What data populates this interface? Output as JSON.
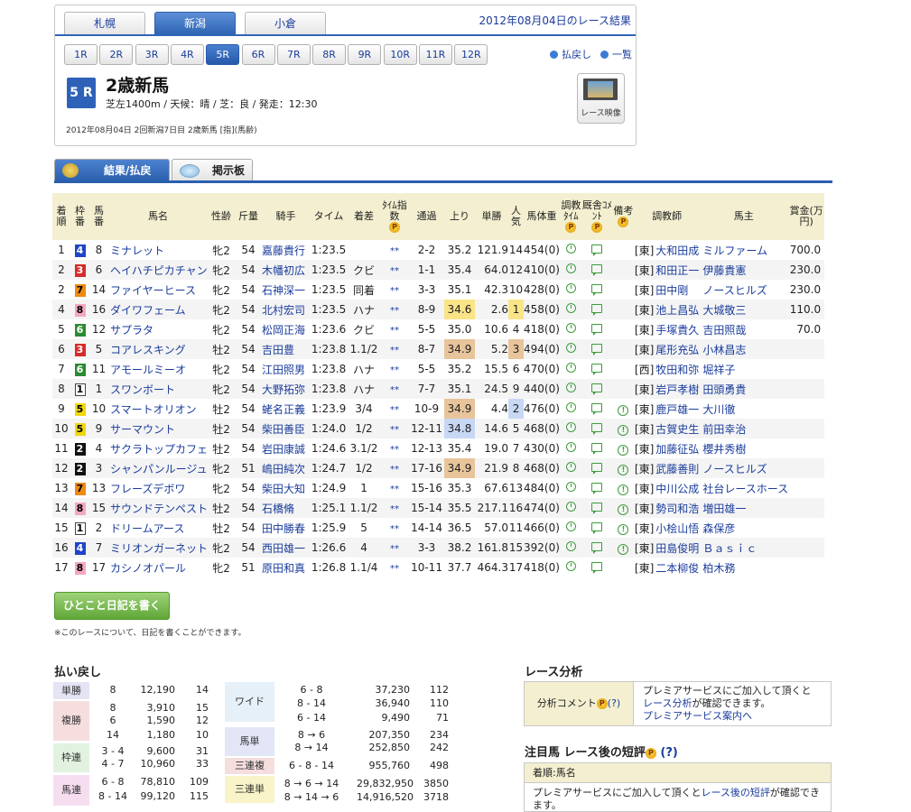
{
  "venues": [
    "札幌",
    "新潟",
    "小倉"
  ],
  "active_venue": 1,
  "date_title": "2012年08月04日のレース結果",
  "race_buttons": [
    "1R",
    "2R",
    "3R",
    "4R",
    "5R",
    "6R",
    "7R",
    "8R",
    "9R",
    "10R",
    "11R",
    "12R"
  ],
  "active_race": 4,
  "links": {
    "payout": "払戻し",
    "list": "一覧"
  },
  "race": {
    "badge": "5 R",
    "name": "2歳新馬",
    "conditions": "芝左1400m /  天候：晴 /  芝：良  /  発走：12:30",
    "info": "2012年08月04日 2回新潟7日目 2歳新馬  [指](馬齢)"
  },
  "video_label": "レース映像",
  "result_tabs": [
    "結果/払戻",
    "掲示板"
  ],
  "headers": {
    "rank": "着順",
    "waku": "枠番",
    "num": "馬番",
    "name": "馬名",
    "sexage": "性齢",
    "weight": "斤量",
    "jockey": "騎手",
    "time": "タイム",
    "margin": "着差",
    "index": "ﾀｲﾑ指数",
    "pass": "通過",
    "last": "上り",
    "odds": "単勝",
    "pop": "人気",
    "body": "馬体重",
    "chokyo": "調教ﾀｲﾑ",
    "kyusha": "厩舎ｺﾒﾝﾄ",
    "biko": "備考",
    "trainer": "調教師",
    "owner": "馬主",
    "prize": "賞金(万円)"
  },
  "rows": [
    {
      "rank": "1",
      "waku": "4",
      "num": "8",
      "name": "ミナレット",
      "sexage": "牝2",
      "weight": "54",
      "jockey": "嘉藤貴行",
      "time": "1:23.5",
      "margin": "",
      "index": "**",
      "pass": "2-2",
      "last": "35.2",
      "odds": "121.9",
      "pop": "14",
      "body": "454(0)",
      "biko": false,
      "stable": "[東]",
      "trainer": "大和田成",
      "owner": "ミルファーム",
      "prize": "700.0"
    },
    {
      "rank": "2",
      "waku": "3",
      "num": "6",
      "name": "ヘイハチピカチャン",
      "sexage": "牝2",
      "weight": "54",
      "jockey": "木幡初広",
      "time": "1:23.5",
      "margin": "クビ",
      "index": "**",
      "pass": "1-1",
      "last": "35.4",
      "odds": "64.0",
      "pop": "12",
      "body": "410(0)",
      "biko": false,
      "stable": "[東]",
      "trainer": "和田正一",
      "owner": "伊藤貴憲",
      "prize": "230.0"
    },
    {
      "rank": "2",
      "waku": "7",
      "num": "14",
      "name": "ファイヤーヒース",
      "sexage": "牝2",
      "weight": "54",
      "jockey": "石神深一",
      "time": "1:23.5",
      "margin": "同着",
      "index": "**",
      "pass": "3-3",
      "last": "35.1",
      "odds": "42.3",
      "pop": "10",
      "body": "428(0)",
      "biko": false,
      "stable": "[東]",
      "trainer": "田中剛",
      "owner": "ノースヒルズ",
      "prize": "230.0"
    },
    {
      "rank": "4",
      "waku": "8",
      "num": "16",
      "name": "ダイワフェーム",
      "sexage": "牝2",
      "weight": "54",
      "jockey": "北村宏司",
      "time": "1:23.5",
      "margin": "ハナ",
      "index": "**",
      "pass": "8-9",
      "last": "34.6",
      "odds": "2.6",
      "pop": "1",
      "body": "458(0)",
      "biko": false,
      "stable": "[東]",
      "trainer": "池上昌弘",
      "owner": "大城敬三",
      "prize": "110.0",
      "hl_last": "y",
      "hl_pop": "y"
    },
    {
      "rank": "5",
      "waku": "6",
      "num": "12",
      "name": "サプラタ",
      "sexage": "牝2",
      "weight": "54",
      "jockey": "松岡正海",
      "time": "1:23.6",
      "margin": "クビ",
      "index": "**",
      "pass": "5-5",
      "last": "35.0",
      "odds": "10.6",
      "pop": "4",
      "body": "418(0)",
      "biko": false,
      "stable": "[東]",
      "trainer": "手塚貴久",
      "owner": "吉田照哉",
      "prize": "70.0"
    },
    {
      "rank": "6",
      "waku": "3",
      "num": "5",
      "name": "コアレスキング",
      "sexage": "牡2",
      "weight": "54",
      "jockey": "吉田豊",
      "time": "1:23.8",
      "margin": "1.1/2",
      "index": "**",
      "pass": "8-7",
      "last": "34.9",
      "odds": "5.2",
      "pop": "3",
      "body": "494(0)",
      "biko": false,
      "stable": "[東]",
      "trainer": "尾形充弘",
      "owner": "小林昌志",
      "prize": "",
      "hl_last": "o",
      "hl_pop": "o"
    },
    {
      "rank": "7",
      "waku": "6",
      "num": "11",
      "name": "アモールミーオ",
      "sexage": "牝2",
      "weight": "54",
      "jockey": "江田照男",
      "time": "1:23.8",
      "margin": "ハナ",
      "index": "**",
      "pass": "5-5",
      "last": "35.2",
      "odds": "15.5",
      "pop": "6",
      "body": "470(0)",
      "biko": false,
      "stable": "[西]",
      "trainer": "牧田和弥",
      "owner": "堀祥子",
      "prize": ""
    },
    {
      "rank": "8",
      "waku": "1",
      "num": "1",
      "name": "スワンボート",
      "sexage": "牝2",
      "weight": "54",
      "jockey": "大野拓弥",
      "time": "1:23.8",
      "margin": "ハナ",
      "index": "**",
      "pass": "7-7",
      "last": "35.1",
      "odds": "24.5",
      "pop": "9",
      "body": "440(0)",
      "biko": false,
      "stable": "[東]",
      "trainer": "岩戸孝樹",
      "owner": "田頭勇貴",
      "prize": ""
    },
    {
      "rank": "9",
      "waku": "5",
      "num": "10",
      "name": "スマートオリオン",
      "sexage": "牡2",
      "weight": "54",
      "jockey": "蛯名正義",
      "time": "1:23.9",
      "margin": "3/4",
      "index": "**",
      "pass": "10-9",
      "last": "34.9",
      "odds": "4.4",
      "pop": "2",
      "body": "476(0)",
      "biko": true,
      "stable": "[東]",
      "trainer": "鹿戸雄一",
      "owner": "大川徹",
      "prize": "",
      "hl_last": "o",
      "hl_pop": "b"
    },
    {
      "rank": "10",
      "waku": "5",
      "num": "9",
      "name": "サーマウント",
      "sexage": "牡2",
      "weight": "54",
      "jockey": "柴田善臣",
      "time": "1:24.0",
      "margin": "1/2",
      "index": "**",
      "pass": "12-11",
      "last": "34.8",
      "odds": "14.6",
      "pop": "5",
      "body": "468(0)",
      "biko": true,
      "stable": "[東]",
      "trainer": "古賀史生",
      "owner": "前田幸治",
      "prize": "",
      "hl_last": "b"
    },
    {
      "rank": "11",
      "waku": "2",
      "num": "4",
      "name": "サクラトップカフェ",
      "sexage": "牡2",
      "weight": "54",
      "jockey": "岩田康誠",
      "time": "1:24.6",
      "margin": "3.1/2",
      "index": "**",
      "pass": "12-13",
      "last": "35.4",
      "odds": "19.0",
      "pop": "7",
      "body": "430(0)",
      "biko": true,
      "stable": "[東]",
      "trainer": "加藤征弘",
      "owner": "櫻井秀樹",
      "prize": ""
    },
    {
      "rank": "12",
      "waku": "2",
      "num": "3",
      "name": "シャンパンルージュ",
      "sexage": "牝2",
      "weight": "51",
      "jockey": "嶋田純次",
      "time": "1:24.7",
      "margin": "1/2",
      "index": "**",
      "pass": "17-16",
      "last": "34.9",
      "odds": "21.9",
      "pop": "8",
      "body": "468(0)",
      "biko": true,
      "stable": "[東]",
      "trainer": "武藤善則",
      "owner": "ノースヒルズ",
      "prize": "",
      "hl_last": "o"
    },
    {
      "rank": "13",
      "waku": "7",
      "num": "13",
      "name": "フレーズデボワ",
      "sexage": "牝2",
      "weight": "54",
      "jockey": "柴田大知",
      "time": "1:24.9",
      "margin": "1",
      "index": "**",
      "pass": "15-16",
      "last": "35.3",
      "odds": "67.6",
      "pop": "13",
      "body": "484(0)",
      "biko": true,
      "stable": "[東]",
      "trainer": "中川公成",
      "owner": "社台レースホース",
      "prize": ""
    },
    {
      "rank": "14",
      "waku": "8",
      "num": "15",
      "name": "サウンドテンペスト",
      "sexage": "牡2",
      "weight": "54",
      "jockey": "石橋脩",
      "time": "1:25.1",
      "margin": "1.1/2",
      "index": "**",
      "pass": "15-14",
      "last": "35.5",
      "odds": "217.1",
      "pop": "16",
      "body": "474(0)",
      "biko": true,
      "stable": "[東]",
      "trainer": "勢司和浩",
      "owner": "増田雄一",
      "prize": ""
    },
    {
      "rank": "15",
      "waku": "1",
      "num": "2",
      "name": "ドリームアース",
      "sexage": "牡2",
      "weight": "54",
      "jockey": "田中勝春",
      "time": "1:25.9",
      "margin": "5",
      "index": "**",
      "pass": "14-14",
      "last": "36.5",
      "odds": "57.0",
      "pop": "11",
      "body": "466(0)",
      "biko": true,
      "stable": "[東]",
      "trainer": "小桧山悟",
      "owner": "森保彦",
      "prize": ""
    },
    {
      "rank": "16",
      "waku": "4",
      "num": "7",
      "name": "ミリオンガーネット",
      "sexage": "牝2",
      "weight": "54",
      "jockey": "西田雄一",
      "time": "1:26.6",
      "margin": "4",
      "index": "**",
      "pass": "3-3",
      "last": "38.2",
      "odds": "161.8",
      "pop": "15",
      "body": "392(0)",
      "biko": true,
      "stable": "[東]",
      "trainer": "田島俊明",
      "owner": "Ｂａｓｉｃ",
      "prize": ""
    },
    {
      "rank": "17",
      "waku": "8",
      "num": "17",
      "name": "カシノオパール",
      "sexage": "牝2",
      "weight": "51",
      "jockey": "原田和真",
      "time": "1:26.8",
      "margin": "1.1/4",
      "index": "**",
      "pass": "10-11",
      "last": "37.7",
      "odds": "464.3",
      "pop": "17",
      "body": "418(0)",
      "biko": false,
      "stable": "[東]",
      "trainer": "二本柳俊",
      "owner": "柏木務",
      "prize": ""
    }
  ],
  "diary": {
    "button": "ひとこと日記を書く",
    "note": "※このレースについて、日記を書くことができます。"
  },
  "payout": {
    "title": "払い戻し",
    "labels": {
      "tansho": "単勝",
      "fukusho": "複勝",
      "wakuren": "枠連",
      "umaren": "馬連",
      "wide": "ワイド",
      "umatan": "馬単",
      "sanrenpuku": "三連複",
      "sanrentan": "三連単"
    },
    "left": [
      [
        "8",
        "12,190",
        "14"
      ],
      [
        "8",
        "3,910",
        "15"
      ],
      [
        "6",
        "1,590",
        "12"
      ],
      [
        "14",
        "1,180",
        "10"
      ],
      [
        "3 - 4",
        "9,600",
        "31"
      ],
      [
        "4 - 7",
        "10,960",
        "33"
      ],
      [
        "6 - 8",
        "78,810",
        "109"
      ],
      [
        "8 - 14",
        "99,120",
        "115"
      ]
    ],
    "right": [
      [
        "6 - 8",
        "37,230",
        "112"
      ],
      [
        "8 - 14",
        "36,940",
        "110"
      ],
      [
        "6 - 14",
        "9,490",
        "71"
      ],
      [
        "8 → 6",
        "207,350",
        "234"
      ],
      [
        "8 → 14",
        "252,850",
        "242"
      ],
      [
        "6 - 8 - 14",
        "955,760",
        "498"
      ],
      [
        "8 → 6 → 14",
        "29,832,950",
        "3850"
      ],
      [
        "8 → 14 → 6",
        "14,916,520",
        "3718"
      ]
    ]
  },
  "analysis": {
    "title": "レース分析",
    "label": "分析コメント",
    "q": "(?)",
    "line1": "プレミアサービスにご加入して頂くと",
    "link1": "レース分析",
    "line2": "が確認できます。",
    "link2": "プレミアサービス案内へ"
  },
  "notable": {
    "title": "注目馬 レース後の短評",
    "q": "(?)",
    "head": "着順:馬名",
    "text1": "プレミアサービスにご加入して頂くと",
    "link": "レース後の短評",
    "text2": "が確認できます。"
  }
}
